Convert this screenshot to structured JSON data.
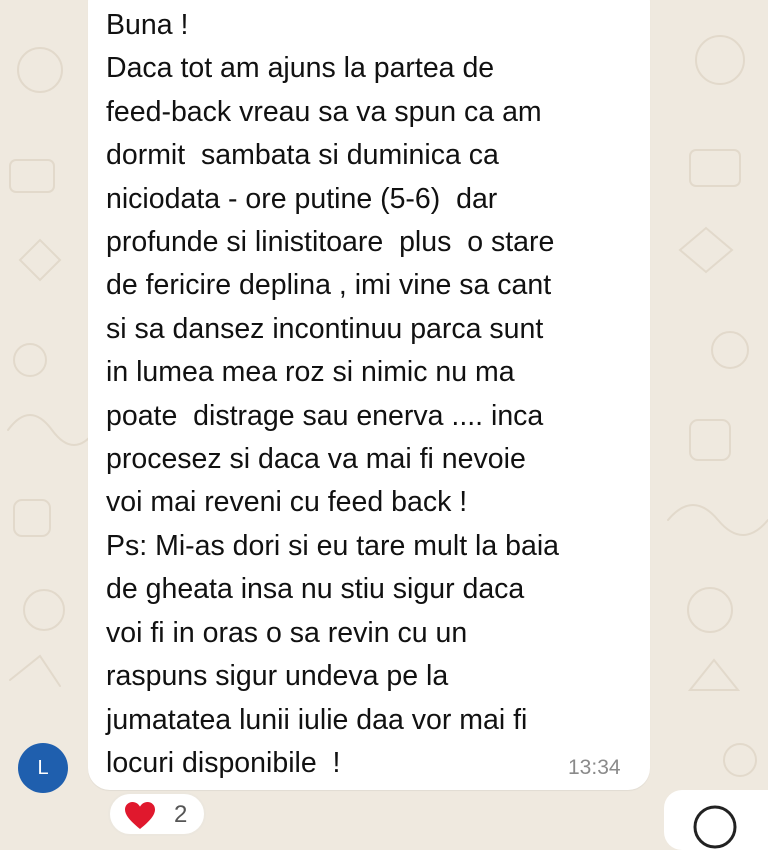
{
  "message": {
    "lines": [
      "Buna !",
      "Daca tot am ajuns la partea de",
      "feed-back vreau sa va spun ca am",
      "dormit  sambata si duminica ca",
      "niciodata - ore putine (5-6)  dar",
      "profunde si linistitoare  plus  o stare",
      "de fericire deplina , imi vine sa cant",
      "si sa dansez incontinuu parca sunt",
      "in lumea mea roz si nimic nu ma",
      "poate  distrage sau enerva .... inca",
      "procesez si daca va mai fi nevoie",
      "voi mai reveni cu feed back !",
      "Ps: Mi-as dori si eu tare mult la baia",
      "de gheata insa nu stiu sigur daca",
      "voi fi in oras o sa revin cu un",
      "raspuns sigur undeva pe la",
      "jumatatea lunii iulie daa vor mai fi",
      "locuri disponibile  !"
    ],
    "timestamp": "13:34"
  },
  "sender": {
    "avatar_initial": "L",
    "avatar_color": "#1f5fae"
  },
  "reaction": {
    "icon": "red-heart-icon",
    "count": "2",
    "color": "#e0182d"
  },
  "colors": {
    "wallpaper": "#efe9df",
    "bubble": "#ffffff",
    "timestamp": "#8a8a8a"
  }
}
